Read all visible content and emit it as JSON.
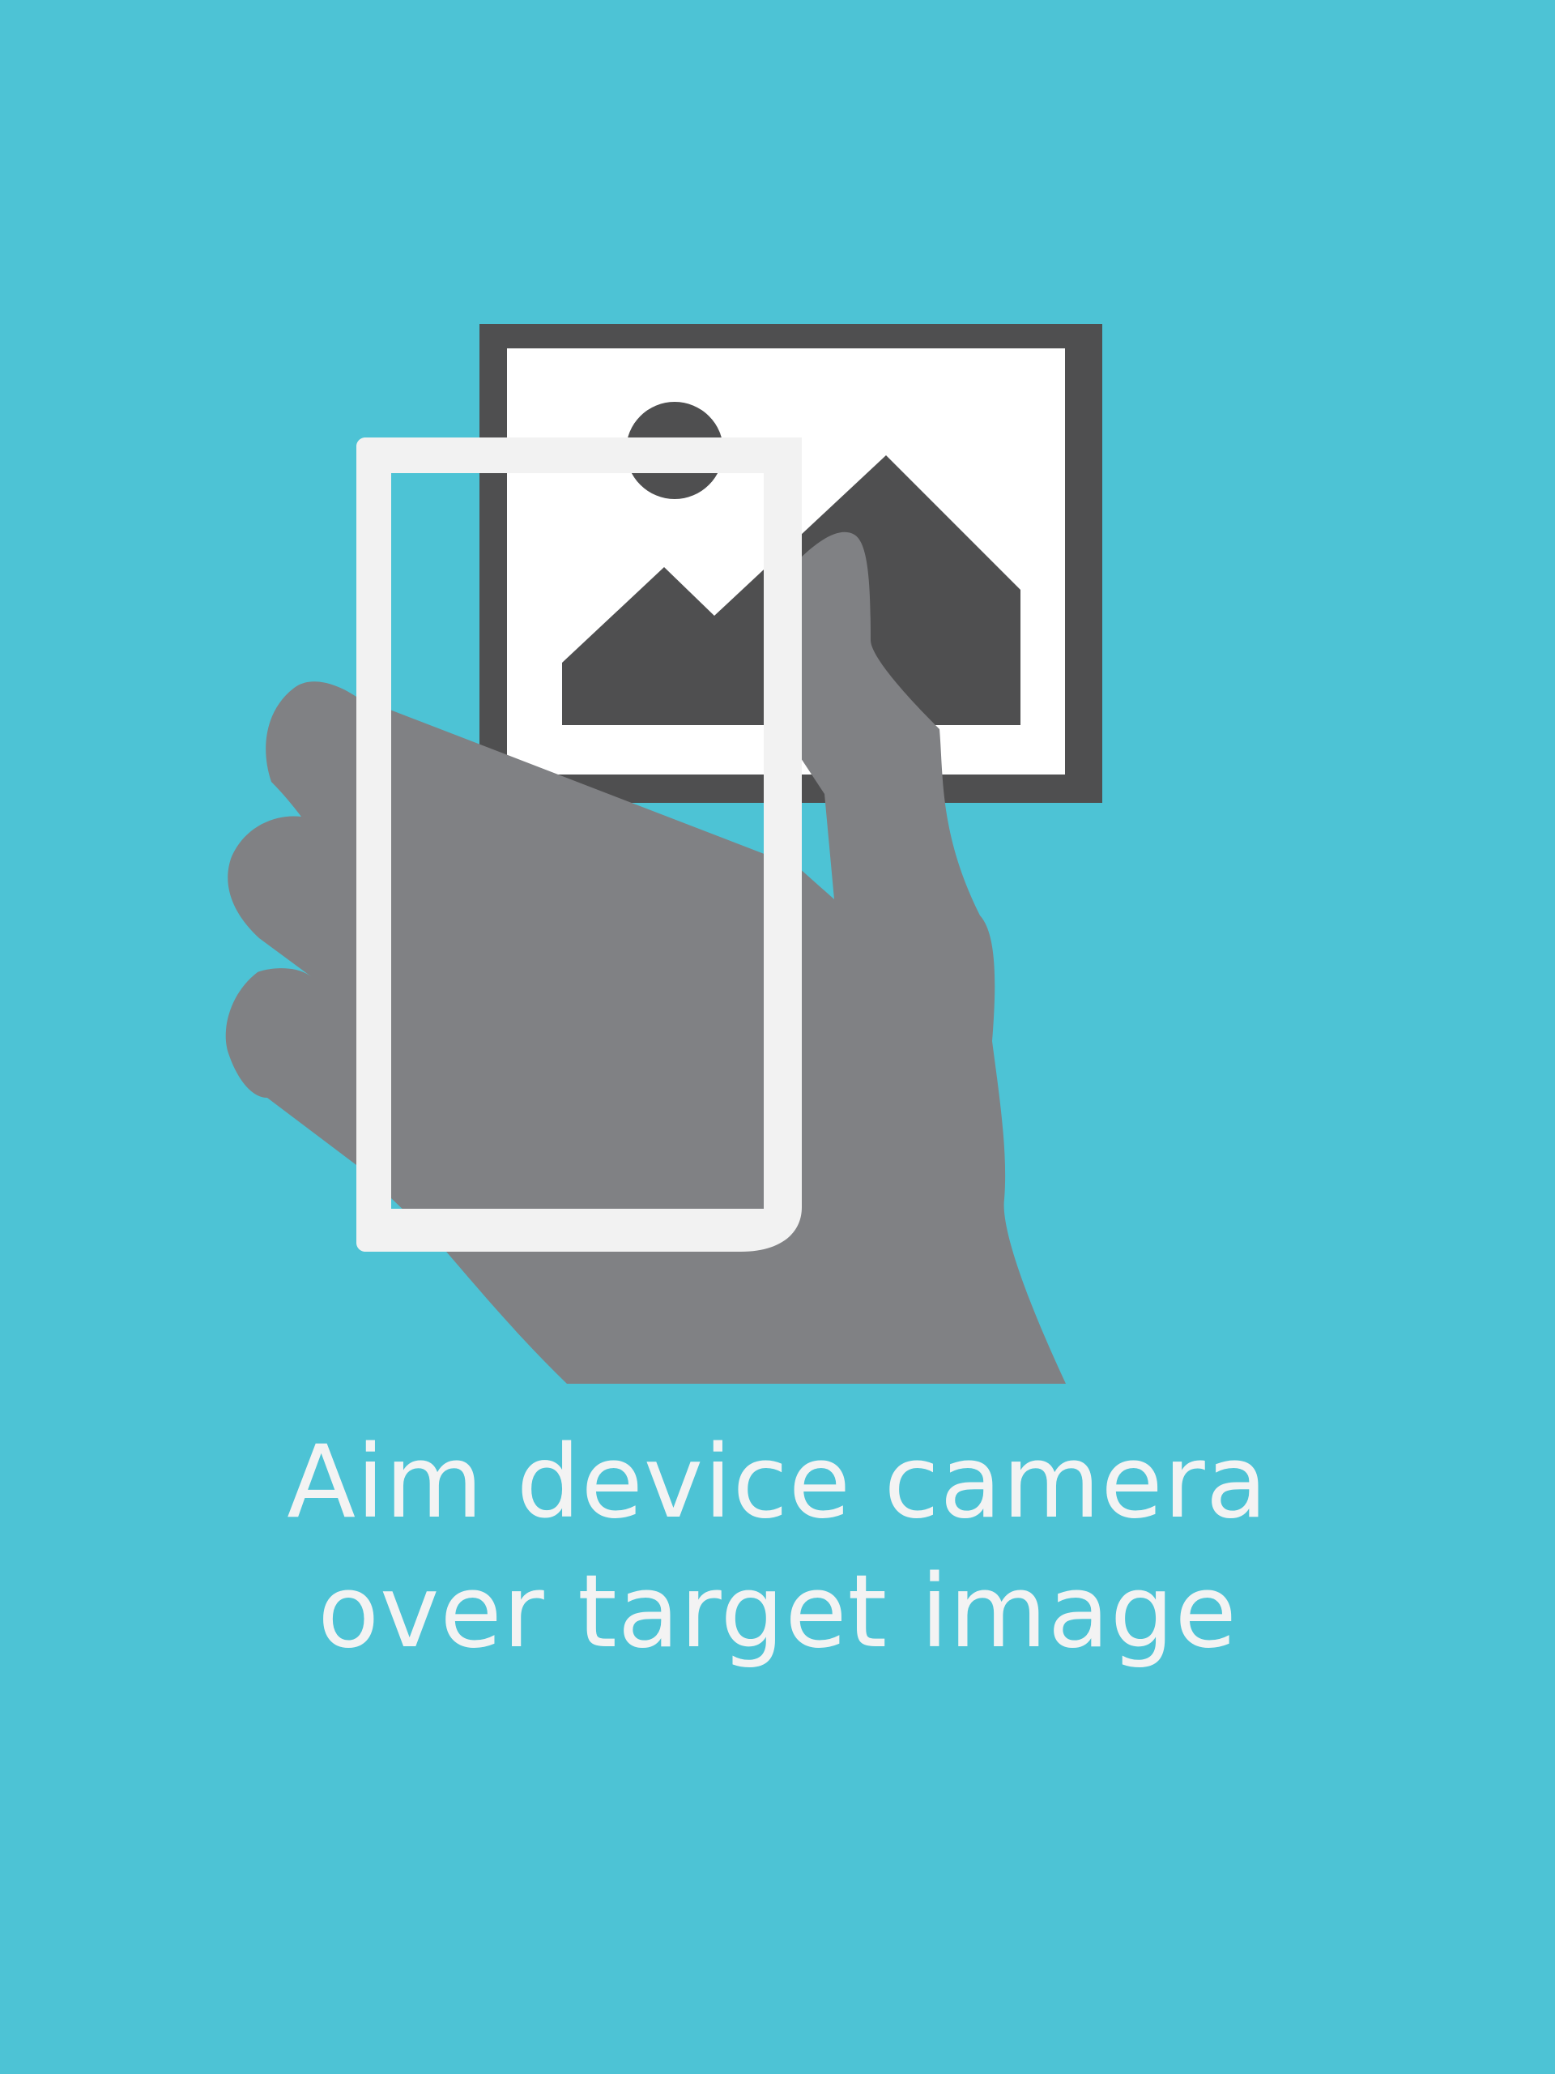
{
  "screen": {
    "background_color": "#4dc3d5"
  },
  "illustration": {
    "icons": [
      "target-image-icon",
      "hand-icon",
      "phone-frame-icon"
    ],
    "colors": {
      "picture_frame": "#4f4f50",
      "picture_paper": "#ffffff",
      "hand": "#808184",
      "phone_frame": "#f2f2f2"
    }
  },
  "instruction": {
    "line1": "Aim device camera",
    "line2": "over target image"
  }
}
